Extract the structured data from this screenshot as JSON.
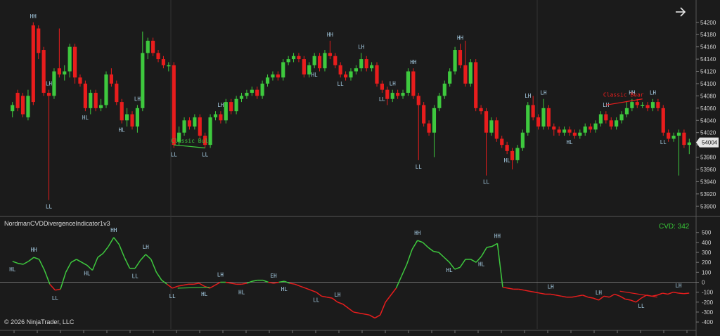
{
  "indicator_title": "NordmanCVDDivergenceIndicator1v3",
  "cvd_readout": "CVD: 342",
  "copyright": "© 2026 NinjaTrader, LLC",
  "nav_arrow_icon": "arrow-right-icon",
  "colors": {
    "up": "#3ec93e",
    "down": "#e81d1d",
    "label": "#a9d0e8",
    "bg": "#1b1b1b",
    "grid": "#2a2a2a"
  },
  "chart_data": [
    {
      "type": "candlestick",
      "name": "price",
      "ylim": [
        53890,
        54225
      ],
      "y_ticks": [
        54200,
        54180,
        54160,
        54140,
        54120,
        54100,
        54080,
        54060,
        54040,
        54020,
        54000,
        53980,
        53960,
        53940,
        53920,
        53900
      ],
      "last_price_label": "54004",
      "candles": [
        [
          54055,
          54065,
          54045,
          54070
        ],
        [
          54085,
          54060,
          54055,
          54090
        ],
        [
          54080,
          54050,
          54045,
          54085
        ],
        [
          54045,
          54080,
          54040,
          54090
        ],
        [
          54195,
          54070,
          54065,
          54200
        ],
        [
          54190,
          54150,
          54140,
          54195
        ],
        [
          54155,
          54085,
          54080,
          54160
        ],
        [
          54085,
          54080,
          53910,
          54090
        ],
        [
          54080,
          54120,
          54075,
          54125
        ],
        [
          54125,
          54115,
          54110,
          54190
        ],
        [
          54115,
          54120,
          54105,
          54130
        ],
        [
          54120,
          54160,
          54110,
          54165
        ],
        [
          54160,
          54110,
          54100,
          54165
        ],
        [
          54110,
          54100,
          54095,
          54115
        ],
        [
          54100,
          54060,
          54055,
          54105
        ],
        [
          54060,
          54085,
          54050,
          54090
        ],
        [
          54085,
          54060,
          54055,
          54090
        ],
        [
          54060,
          54065,
          54055,
          54075
        ],
        [
          54065,
          54115,
          54060,
          54120
        ],
        [
          54115,
          54100,
          54095,
          54125
        ],
        [
          54100,
          54070,
          54065,
          54105
        ],
        [
          54070,
          54040,
          54035,
          54075
        ],
        [
          54040,
          54050,
          54030,
          54060
        ],
        [
          54050,
          54030,
          54025,
          54055
        ],
        [
          54030,
          54060,
          54020,
          54065
        ],
        [
          54060,
          54150,
          54055,
          54185
        ],
        [
          54150,
          54170,
          54140,
          54175
        ],
        [
          54170,
          54150,
          54145,
          54175
        ],
        [
          54150,
          54140,
          54135,
          54155
        ],
        [
          54140,
          54130,
          54125,
          54145
        ],
        [
          54130,
          54130,
          54120,
          54135
        ],
        [
          54130,
          54000,
          53995,
          54135
        ],
        [
          54005,
          54020,
          54000,
          54030
        ],
        [
          54020,
          54040,
          54015,
          54045
        ],
        [
          54040,
          54030,
          54025,
          54045
        ],
        [
          54030,
          54045,
          54025,
          54050
        ],
        [
          54045,
          54015,
          54010,
          54050
        ],
        [
          54015,
          54000,
          53995,
          54020
        ],
        [
          54000,
          54045,
          53995,
          54050
        ],
        [
          54045,
          54050,
          54040,
          54055
        ],
        [
          54050,
          54040,
          54035,
          54055
        ],
        [
          54040,
          54070,
          54035,
          54075
        ],
        [
          54070,
          54055,
          54050,
          54075
        ],
        [
          54055,
          54075,
          54050,
          54080
        ],
        [
          54075,
          54080,
          54070,
          54085
        ],
        [
          54080,
          54085,
          54075,
          54090
        ],
        [
          54085,
          54090,
          54080,
          54095
        ],
        [
          54090,
          54080,
          54075,
          54095
        ],
        [
          54080,
          54100,
          54075,
          54105
        ],
        [
          54100,
          54110,
          54095,
          54115
        ],
        [
          54110,
          54115,
          54105,
          54120
        ],
        [
          54115,
          54110,
          54105,
          54120
        ],
        [
          54110,
          54135,
          54105,
          54140
        ],
        [
          54135,
          54140,
          54130,
          54145
        ],
        [
          54140,
          54145,
          54135,
          54150
        ],
        [
          54145,
          54140,
          54135,
          54150
        ],
        [
          54140,
          54115,
          54110,
          54145
        ],
        [
          54115,
          54130,
          54110,
          54135
        ],
        [
          54130,
          54145,
          54125,
          54150
        ],
        [
          54145,
          54125,
          54120,
          54150
        ],
        [
          54125,
          54150,
          54120,
          54155
        ],
        [
          54150,
          54145,
          54140,
          54170
        ],
        [
          54145,
          54130,
          54125,
          54150
        ],
        [
          54130,
          54115,
          54110,
          54135
        ],
        [
          54115,
          54110,
          54105,
          54120
        ],
        [
          54110,
          54120,
          54105,
          54125
        ],
        [
          54120,
          54125,
          54115,
          54130
        ],
        [
          54125,
          54140,
          54120,
          54150
        ],
        [
          54140,
          54125,
          54120,
          54145
        ],
        [
          54125,
          54130,
          54120,
          54135
        ],
        [
          54130,
          54100,
          54095,
          54135
        ],
        [
          54100,
          54090,
          54085,
          54105
        ],
        [
          54090,
          54075,
          54065,
          54095
        ],
        [
          54075,
          54085,
          54070,
          54090
        ],
        [
          54085,
          54080,
          54075,
          54090
        ],
        [
          54080,
          54085,
          54075,
          54090
        ],
        [
          54085,
          54120,
          54080,
          54125
        ],
        [
          54120,
          54080,
          54075,
          54125
        ],
        [
          54080,
          54065,
          53975,
          54085
        ],
        [
          54065,
          54035,
          54030,
          54070
        ],
        [
          54035,
          54020,
          54015,
          54040
        ],
        [
          54020,
          54060,
          53980,
          54065
        ],
        [
          54060,
          54080,
          54055,
          54085
        ],
        [
          54080,
          54100,
          54075,
          54105
        ],
        [
          54100,
          54120,
          54095,
          54125
        ],
        [
          54120,
          54155,
          54115,
          54160
        ],
        [
          54155,
          54130,
          54125,
          54165
        ],
        [
          54130,
          54100,
          54095,
          54170
        ],
        [
          54100,
          54135,
          54095,
          54140
        ],
        [
          54135,
          54060,
          54055,
          54140
        ],
        [
          54060,
          54055,
          54050,
          54065
        ],
        [
          54055,
          54020,
          53950,
          54060
        ],
        [
          54020,
          54040,
          54015,
          54045
        ],
        [
          54040,
          54010,
          54005,
          54045
        ],
        [
          54010,
          54000,
          53995,
          54015
        ],
        [
          54000,
          53990,
          53985,
          54005
        ],
        [
          53990,
          53975,
          53960,
          53995
        ],
        [
          53975,
          53995,
          53970,
          54000
        ],
        [
          53995,
          54020,
          53990,
          54025
        ],
        [
          54020,
          54065,
          54015,
          54070
        ],
        [
          54065,
          54045,
          54040,
          54080
        ],
        [
          54045,
          54030,
          54025,
          54050
        ],
        [
          54030,
          54060,
          54025,
          54075
        ],
        [
          54060,
          54030,
          54025,
          54065
        ],
        [
          54030,
          54025,
          54015,
          54035
        ],
        [
          54025,
          54020,
          54015,
          54030
        ],
        [
          54020,
          54025,
          54015,
          54030
        ],
        [
          54025,
          54020,
          54015,
          54030
        ],
        [
          54020,
          54015,
          54010,
          54025
        ],
        [
          54015,
          54020,
          54010,
          54025
        ],
        [
          54020,
          54030,
          54015,
          54035
        ],
        [
          54030,
          54025,
          54020,
          54035
        ],
        [
          54025,
          54035,
          54020,
          54040
        ],
        [
          54035,
          54050,
          54030,
          54055
        ],
        [
          54050,
          54040,
          54035,
          54055
        ],
        [
          54040,
          54030,
          54025,
          54045
        ],
        [
          54030,
          54040,
          54025,
          54045
        ],
        [
          54040,
          54050,
          54035,
          54055
        ],
        [
          54050,
          54060,
          54045,
          54070
        ],
        [
          54060,
          54070,
          54055,
          54075
        ],
        [
          54070,
          54065,
          54060,
          54075
        ],
        [
          54065,
          54065,
          54060,
          54070
        ],
        [
          54065,
          54060,
          54055,
          54070
        ],
        [
          54060,
          54070,
          54055,
          54075
        ],
        [
          54070,
          54060,
          54055,
          54075
        ],
        [
          54060,
          54020,
          54015,
          54065
        ],
        [
          54020,
          54010,
          54005,
          54025
        ],
        [
          54010,
          54015,
          54005,
          54020
        ],
        [
          54015,
          54020,
          53950,
          54025
        ],
        [
          54020,
          54000,
          53995,
          54025
        ],
        [
          54000,
          54004,
          53985,
          54010
        ]
      ],
      "pivot_labels": [
        {
          "text": "HH",
          "i": 4,
          "pos": "top"
        },
        {
          "text": "LH",
          "i": 7,
          "pos": "top"
        },
        {
          "text": "LL",
          "i": 7,
          "pos": "bottom"
        },
        {
          "text": "HL",
          "i": 14,
          "pos": "bottom"
        },
        {
          "text": "HL",
          "i": 21,
          "pos": "bottom"
        },
        {
          "text": "LH",
          "i": 24,
          "pos": "top"
        },
        {
          "text": "LL",
          "i": 31,
          "pos": "bottom"
        },
        {
          "text": "LL",
          "i": 37,
          "pos": "bottom"
        },
        {
          "text": "LH",
          "i": 40,
          "pos": "top"
        },
        {
          "text": "HH",
          "i": 61,
          "pos": "top"
        },
        {
          "text": "HL",
          "i": 58,
          "pos": "bottom"
        },
        {
          "text": "LL",
          "i": 63,
          "pos": "bottom"
        },
        {
          "text": "LH",
          "i": 67,
          "pos": "top"
        },
        {
          "text": "LL",
          "i": 71,
          "pos": "bottom"
        },
        {
          "text": "LH",
          "i": 73,
          "pos": "top"
        },
        {
          "text": "HH",
          "i": 77,
          "pos": "top"
        },
        {
          "text": "LL",
          "i": 78,
          "pos": "bottom"
        },
        {
          "text": "HH",
          "i": 86,
          "pos": "top"
        },
        {
          "text": "LL",
          "i": 91,
          "pos": "bottom"
        },
        {
          "text": "HL",
          "i": 95,
          "pos": "bottom"
        },
        {
          "text": "LH",
          "i": 99,
          "pos": "top"
        },
        {
          "text": "LH",
          "i": 102,
          "pos": "top"
        },
        {
          "text": "HL",
          "i": 107,
          "pos": "bottom"
        },
        {
          "text": "LH",
          "i": 114,
          "pos": "top"
        },
        {
          "text": "HH",
          "i": 119,
          "pos": "top"
        },
        {
          "text": "LH",
          "i": 123,
          "pos": "top"
        },
        {
          "text": "LL",
          "i": 125,
          "pos": "bottom"
        }
      ],
      "divergence_annotations": [
        {
          "text": "Classic Bull",
          "color": "#3ec93e",
          "from": [
            31,
            54000
          ],
          "to": [
            37,
            53995
          ]
        },
        {
          "text": "Classic Bear",
          "color": "#e81d1d",
          "from": [
            114,
            54065
          ],
          "to": [
            121,
            54075
          ]
        }
      ]
    },
    {
      "type": "line",
      "name": "CVD",
      "ylim": [
        -470,
        590
      ],
      "y_ticks": [
        500,
        400,
        300,
        200,
        100,
        0,
        -100,
        -200,
        -300,
        -400
      ],
      "values": [
        210,
        190,
        180,
        210,
        250,
        230,
        120,
        -20,
        -80,
        -70,
        100,
        200,
        230,
        200,
        170,
        120,
        250,
        290,
        360,
        450,
        380,
        250,
        140,
        140,
        220,
        280,
        230,
        100,
        20,
        -20,
        -60,
        -40,
        -30,
        -20,
        -20,
        -10,
        -40,
        -60,
        -30,
        0,
        0,
        -10,
        -20,
        -20,
        -10,
        10,
        20,
        20,
        0,
        -10,
        0,
        10,
        -10,
        -20,
        -40,
        -60,
        -80,
        -100,
        -140,
        -150,
        -160,
        -200,
        -220,
        -260,
        -300,
        -310,
        -320,
        -330,
        -360,
        -330,
        -200,
        -130,
        -60,
        60,
        180,
        330,
        420,
        400,
        350,
        310,
        300,
        250,
        200,
        130,
        150,
        230,
        230,
        200,
        260,
        350,
        360,
        390,
        -50,
        -60,
        -70,
        -70,
        -80,
        -90,
        -100,
        -110,
        -120,
        -120,
        -130,
        -140,
        -150,
        -150,
        -140,
        -130,
        -150,
        -160,
        -180,
        -140,
        -150,
        -120,
        -140,
        -170,
        -180,
        -200,
        -160,
        -130,
        -140,
        -130,
        -110,
        -120,
        -100,
        -110,
        -115,
        -110
      ],
      "pivot_labels": [
        {
          "text": "HL",
          "i": 0,
          "pos": "bottom"
        },
        {
          "text": "HH",
          "i": 4,
          "pos": "top"
        },
        {
          "text": "LL",
          "i": 8,
          "pos": "bottom"
        },
        {
          "text": "HL",
          "i": 14,
          "pos": "bottom"
        },
        {
          "text": "HH",
          "i": 19,
          "pos": "top"
        },
        {
          "text": "LL",
          "i": 23,
          "pos": "bottom"
        },
        {
          "text": "LH",
          "i": 25,
          "pos": "top"
        },
        {
          "text": "LL",
          "i": 30,
          "pos": "bottom"
        },
        {
          "text": "HL",
          "i": 36,
          "pos": "bottom"
        },
        {
          "text": "LH",
          "i": 39,
          "pos": "top"
        },
        {
          "text": "HL",
          "i": 43,
          "pos": "bottom"
        },
        {
          "text": "EH",
          "i": 49,
          "pos": "top"
        },
        {
          "text": "HL",
          "i": 51,
          "pos": "bottom"
        },
        {
          "text": "LL",
          "i": 57,
          "pos": "bottom"
        },
        {
          "text": "LH",
          "i": 61,
          "pos": "top"
        },
        {
          "text": "HH",
          "i": 76,
          "pos": "top"
        },
        {
          "text": "HL",
          "i": 82,
          "pos": "bottom"
        },
        {
          "text": "HL",
          "i": 88,
          "pos": "bottom"
        },
        {
          "text": "HH",
          "i": 91,
          "pos": "top"
        },
        {
          "text": "LH",
          "i": 101,
          "pos": "top"
        },
        {
          "text": "LH",
          "i": 110,
          "pos": "top"
        },
        {
          "text": "LL",
          "i": 118,
          "pos": "bottom"
        },
        {
          "text": "LH",
          "i": 125,
          "pos": "top"
        }
      ],
      "divergence_lines": [
        {
          "color": "#3ec93e",
          "from": [
            31,
            -60
          ],
          "to": [
            37,
            -50
          ]
        },
        {
          "color": "#e81d1d",
          "from": [
            114,
            -90
          ],
          "to": [
            121,
            -150
          ]
        }
      ]
    }
  ]
}
